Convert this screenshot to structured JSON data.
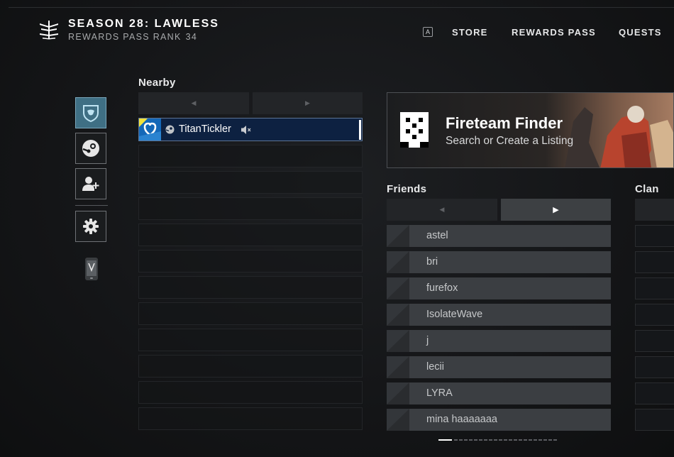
{
  "header": {
    "season_title": "SEASON 28: LAWLESS",
    "rank_label": "REWARDS PASS RANK",
    "rank_value": "34",
    "key_hint": "A",
    "nav": [
      "STORE",
      "REWARDS PASS",
      "QUESTS"
    ]
  },
  "rail": {
    "icons": [
      "clan-shield-icon",
      "steam-icon",
      "add-friend-icon",
      "gear-icon",
      "companion-app-icon"
    ],
    "active": "clan-shield-icon"
  },
  "nearby": {
    "label": "Nearby",
    "player": {
      "name": "TitanTickler",
      "platform_icon": "steam-icon",
      "muted": true
    }
  },
  "fireteam_finder": {
    "title": "Fireteam Finder",
    "subtitle": "Search or Create a Listing"
  },
  "friends": {
    "label": "Friends",
    "items": [
      "astel",
      "bri",
      "furefox",
      "IsolateWave",
      "j",
      "lecii",
      "LYRA",
      "mina haaaaaaa"
    ]
  },
  "clan": {
    "label": "Clan"
  },
  "colors": {
    "accent": "#3f6f84",
    "selected_row": "#0d2141",
    "friend_row": "#3b3e42"
  }
}
